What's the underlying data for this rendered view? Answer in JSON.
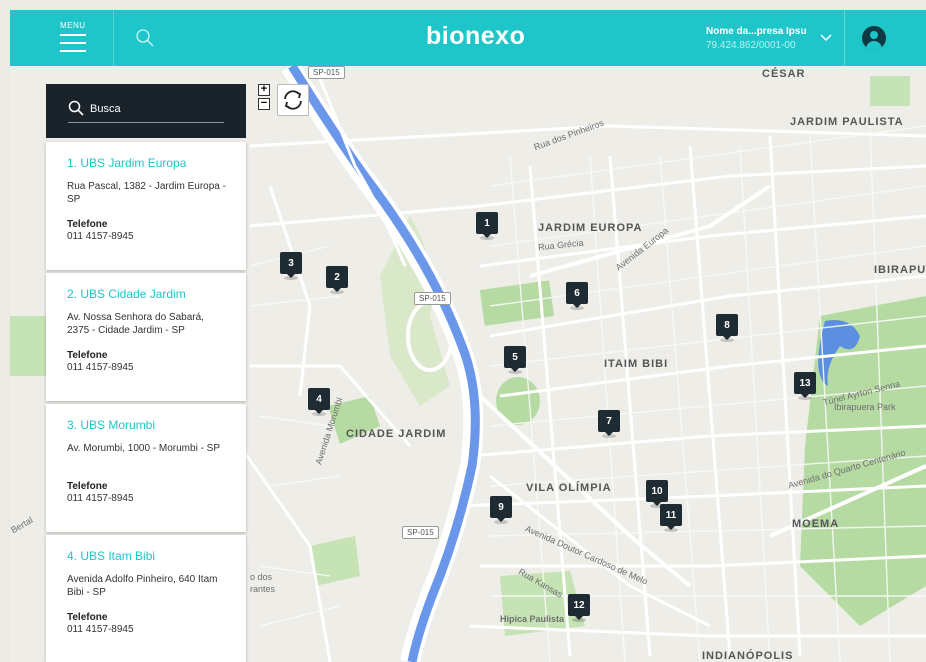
{
  "header": {
    "menu_label": "MENU",
    "logo": "bionexo",
    "company_name": "Nome da...presa Ipsu",
    "company_id": "79.424.862/0001-00",
    "accent_color": "#1ec6c9"
  },
  "search": {
    "placeholder": "Busca"
  },
  "results": [
    {
      "title": "1. UBS Jardim Europa",
      "address": "Rua Pascal, 1382 - Jardim Europa - SP",
      "phone_label": "Telefone",
      "phone": "011 4157-8945"
    },
    {
      "title": "2. UBS Cidade Jardim",
      "address": "Av. Nossa Senhora do Sabará, 2375 - Cidade Jardim - SP",
      "phone_label": "Telefone",
      "phone": "011 4157-8945"
    },
    {
      "title": "3. UBS Morumbi",
      "address": "Av. Morumbi, 1000 - Morumbi - SP",
      "phone_label": "Telefone",
      "phone": "011 4157-8945"
    },
    {
      "title": "4. UBS Itam Bibi",
      "address": "Avenida Adolfo Pinheiro, 640 Itam Bibi - SP",
      "phone_label": "Telefone",
      "phone": "011 4157-8945"
    }
  ],
  "map": {
    "zoom_in": "+",
    "zoom_out": "−",
    "markers": [
      "1",
      "2",
      "3",
      "4",
      "5",
      "6",
      "7",
      "8",
      "9",
      "10",
      "11",
      "12",
      "13"
    ],
    "areas": [
      "CÉSAR",
      "JARDIM PAULISTA",
      "JARDIM EUROPA",
      "IBIRAPU",
      "ITAIM BIBI",
      "CIDADE JARDIM",
      "VILA OLÍMPIA",
      "MOEMA",
      "INDIANÓPOLIS"
    ],
    "streets": [
      "Rua dos Pinheiros",
      "Rua Grécia",
      "Avenida Europa",
      "Avenida Morumbi",
      "Avenida Doutor Cardoso de Melo",
      "Rua Kansas",
      "Avenida do Quarto Centenário",
      "Túnel Ayrton Senna",
      "Ibirapuera Park",
      "Hípica Paulista",
      "o dos",
      "rantes",
      "Bertal"
    ],
    "shields": [
      "SP-015",
      "SP-015",
      "SP-015"
    ]
  }
}
